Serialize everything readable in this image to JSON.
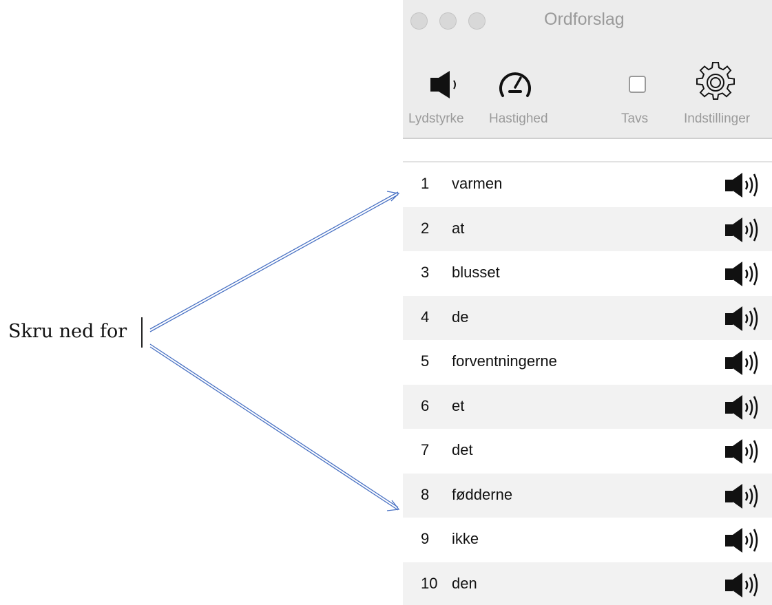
{
  "editor": {
    "typed_text": "Skru ned for"
  },
  "window": {
    "title": "Ordforslag",
    "toolbar": {
      "volume_label": "Lydstyrke",
      "speed_label": "Hastighed",
      "silent_label": "Tavs",
      "silent_checked": false,
      "settings_label": "Indstillinger"
    }
  },
  "suggestions": [
    {
      "num": "1",
      "word": "varmen"
    },
    {
      "num": "2",
      "word": "at"
    },
    {
      "num": "3",
      "word": "blusset"
    },
    {
      "num": "4",
      "word": "de"
    },
    {
      "num": "5",
      "word": "forventningerne"
    },
    {
      "num": "6",
      "word": "et"
    },
    {
      "num": "7",
      "word": "det"
    },
    {
      "num": "8",
      "word": "fødderne"
    },
    {
      "num": "9",
      "word": "ikke"
    },
    {
      "num": "10",
      "word": "den"
    }
  ],
  "colors": {
    "arrow": "#4a72c4",
    "titlebar": "#ececec",
    "row_alt": "#f2f2f2"
  },
  "icons": {
    "volume": "speaker-icon",
    "speed": "speedometer-icon",
    "settings": "gear-icon",
    "row_speaker": "speaker-icon"
  }
}
